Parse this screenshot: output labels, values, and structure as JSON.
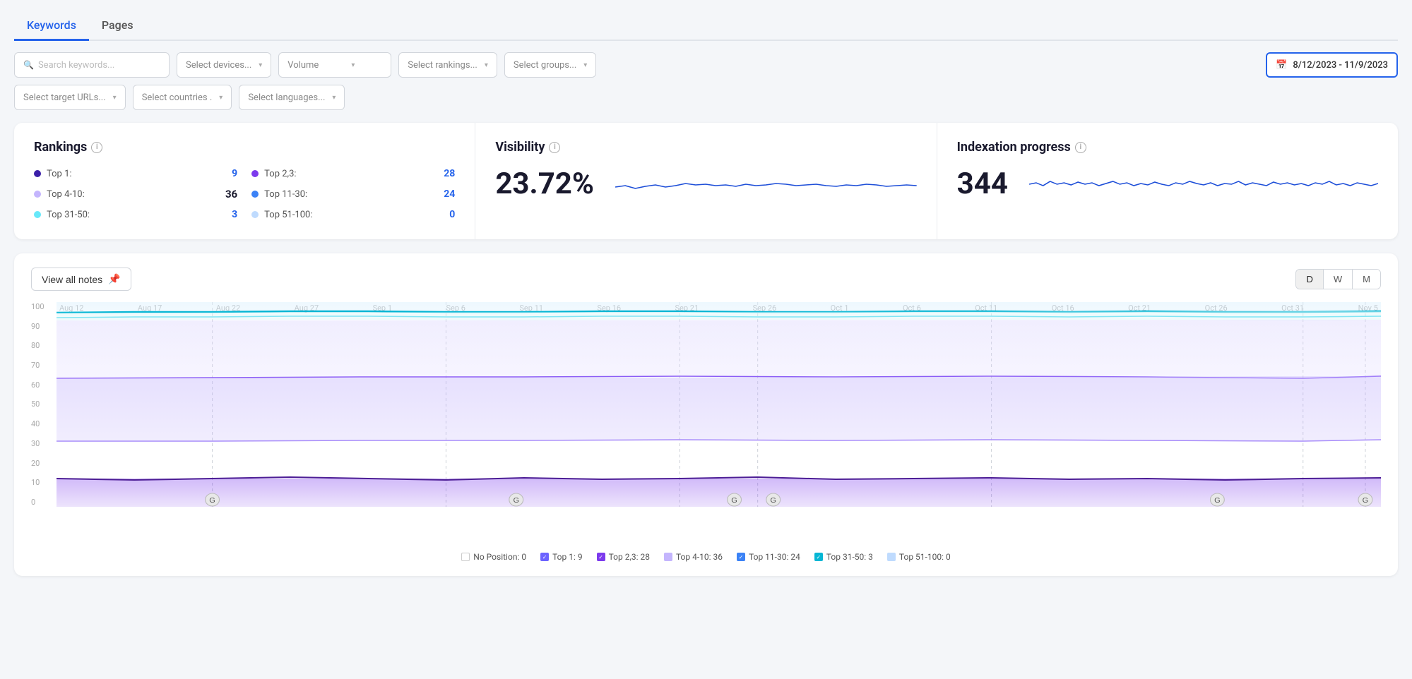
{
  "tabs": [
    {
      "id": "keywords",
      "label": "Keywords",
      "active": true
    },
    {
      "id": "pages",
      "label": "Pages",
      "active": false
    }
  ],
  "filters": {
    "search_placeholder": "Search keywords...",
    "devices_placeholder": "Select devices...",
    "volume_placeholder": "Volume",
    "rankings_placeholder": "Select rankings...",
    "groups_placeholder": "Select groups...",
    "date_range": "8/12/2023 - 11/9/2023",
    "target_urls_placeholder": "Select target URLs...",
    "countries_placeholder": "Select countries .",
    "languages_placeholder": "Select languages..."
  },
  "rankings": {
    "title": "Rankings",
    "items": [
      {
        "label": "Top 1:",
        "value": "9",
        "color": "#3b1fa8"
      },
      {
        "label": "Top 4-10:",
        "value": "36",
        "color": "#c4b5fd"
      },
      {
        "label": "Top 31-50:",
        "value": "3",
        "color": "#67e8f9"
      },
      {
        "label": "Top 2,3:",
        "value": "28",
        "color": "#7c3aed"
      },
      {
        "label": "Top 11-30:",
        "value": "24",
        "color": "#3b82f6"
      },
      {
        "label": "Top 51-100:",
        "value": "0",
        "color": "#bfdbfe"
      }
    ]
  },
  "visibility": {
    "title": "Visibility",
    "value": "23.72%"
  },
  "indexation": {
    "title": "Indexation progress",
    "value": "344"
  },
  "chart": {
    "view_notes_label": "View all notes",
    "period_buttons": [
      "D",
      "W",
      "M"
    ],
    "active_period": "D",
    "y_labels": [
      "100",
      "90",
      "80",
      "70",
      "60",
      "50",
      "40",
      "30",
      "20",
      "10",
      "0"
    ],
    "x_labels": [
      "Aug 12",
      "Aug 17",
      "Aug 22",
      "Aug 27",
      "Sep 1",
      "Sep 6",
      "Sep 11",
      "Sep 16",
      "Sep 21",
      "Sep 26",
      "Oct 1",
      "Oct 6",
      "Oct 11",
      "Oct 16",
      "Oct 21",
      "Oct 26",
      "Oct 31",
      "Nov 5"
    ]
  },
  "legend": [
    {
      "label": "No Position: 0",
      "type": "empty",
      "color": ""
    },
    {
      "label": "Top 1: 9",
      "type": "filled",
      "color": "#5b21b6"
    },
    {
      "label": "Top 2,3: 28",
      "type": "filled",
      "color": "#7c3aed"
    },
    {
      "label": "Top 4-10: 36",
      "type": "filled",
      "color": "#c4b5fd"
    },
    {
      "label": "Top 11-30: 24",
      "type": "filled_blue",
      "color": "#3b82f6"
    },
    {
      "label": "Top 31-50: 3",
      "type": "filled_cyan",
      "color": "#67e8f9"
    },
    {
      "label": "Top 51-100: 0",
      "type": "light_blue",
      "color": "#bfdbfe"
    }
  ],
  "icons": {
    "search": "🔍",
    "calendar": "📅",
    "pin": "📌",
    "chevron": "▾",
    "info": "i",
    "check": "✓"
  }
}
